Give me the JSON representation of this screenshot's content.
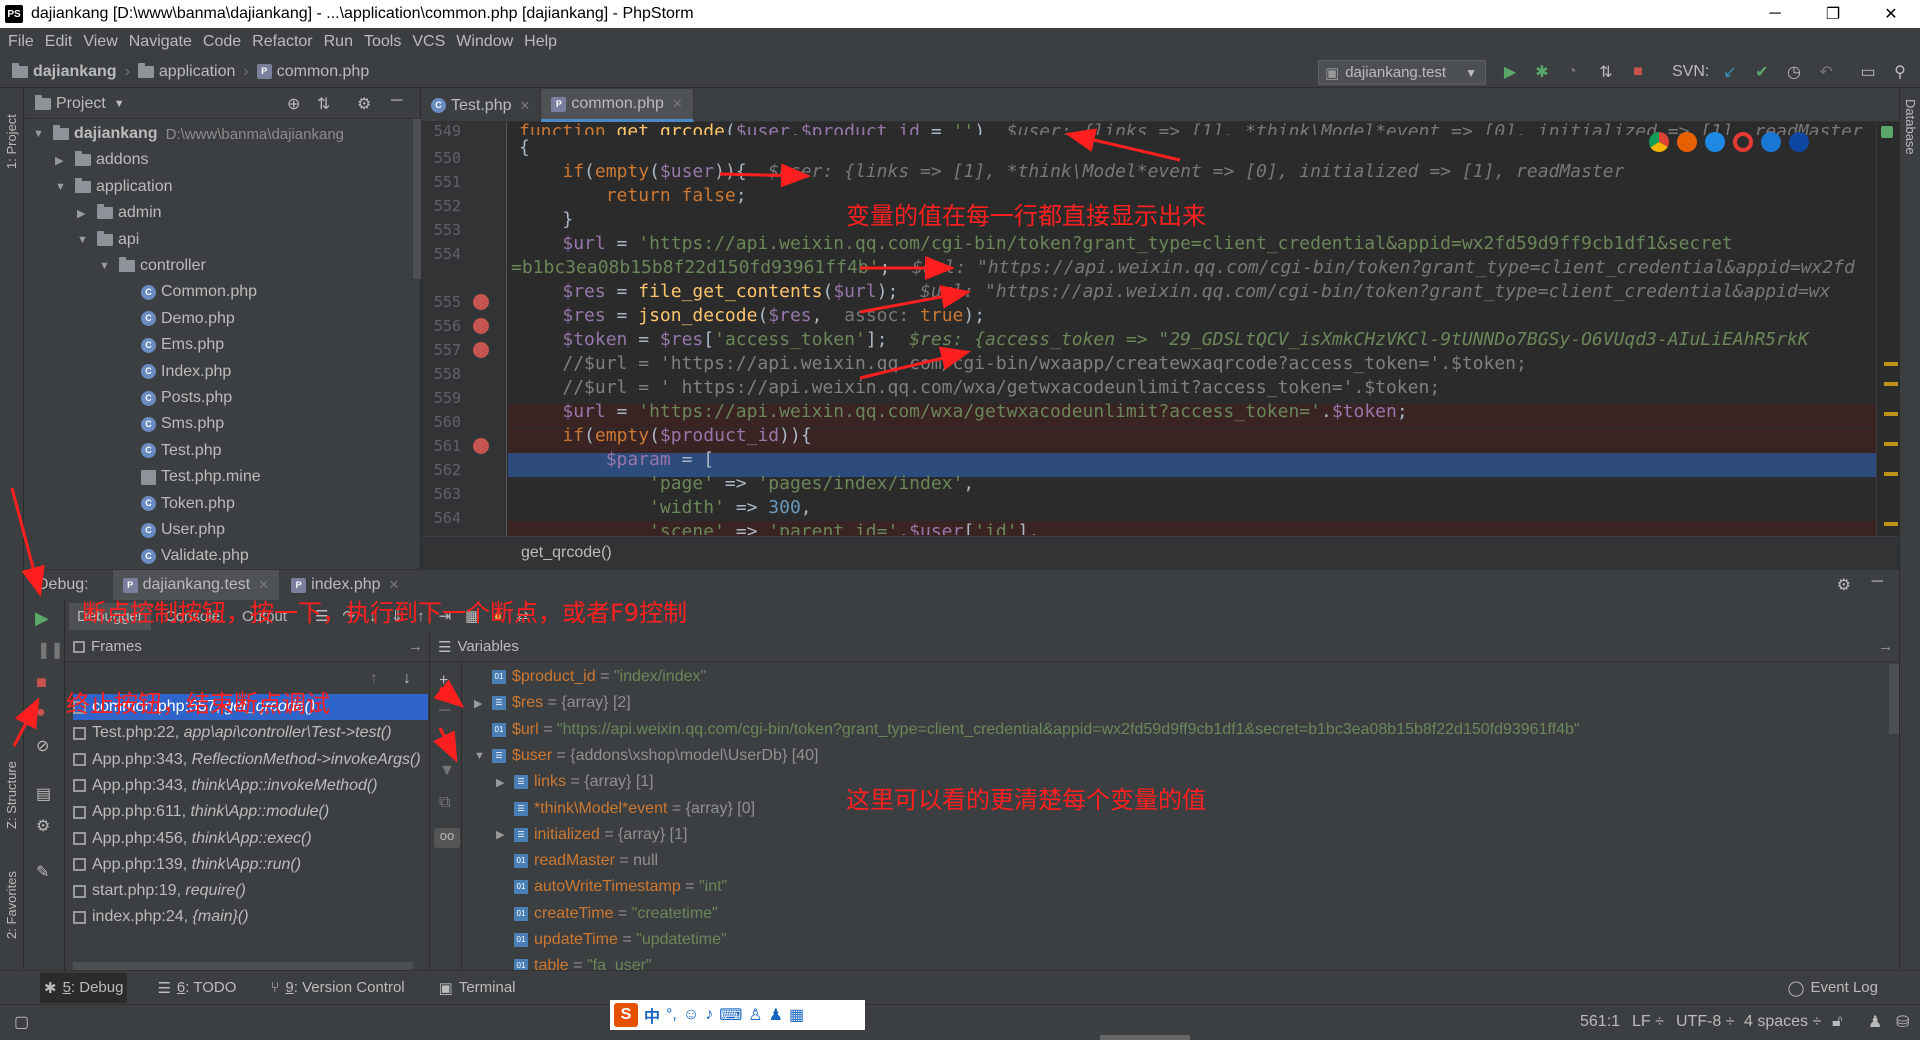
{
  "window": {
    "title": "dajiankang [D:\\www\\banma\\dajiankang] - ...\\application\\common.php [dajiankang] - PhpStorm",
    "logo": "PS"
  },
  "menu": [
    "File",
    "Edit",
    "View",
    "Navigate",
    "Code",
    "Refactor",
    "Run",
    "Tools",
    "VCS",
    "Window",
    "Help"
  ],
  "nav": {
    "root": "dajiankang",
    "folder": "application",
    "file": "common.php",
    "run_config": "dajiankang.test",
    "svn_label": "SVN:"
  },
  "project": {
    "header": "Project",
    "root_name": "dajiankang",
    "root_path": "D:\\www\\banma\\dajiankang",
    "items": [
      {
        "label": "addons",
        "type": "folder",
        "depth": 1,
        "arrow": "▶"
      },
      {
        "label": "application",
        "type": "folder",
        "depth": 1,
        "arrow": "▼"
      },
      {
        "label": "admin",
        "type": "folder",
        "depth": 2,
        "arrow": "▶"
      },
      {
        "label": "api",
        "type": "folder",
        "depth": 2,
        "arrow": "▼"
      },
      {
        "label": "controller",
        "type": "folder",
        "depth": 3,
        "arrow": "▼"
      },
      {
        "label": "Common.php",
        "type": "php",
        "depth": 4
      },
      {
        "label": "Demo.php",
        "type": "php",
        "depth": 4
      },
      {
        "label": "Ems.php",
        "type": "php",
        "depth": 4
      },
      {
        "label": "Index.php",
        "type": "php",
        "depth": 4
      },
      {
        "label": "Posts.php",
        "type": "php",
        "depth": 4
      },
      {
        "label": "Sms.php",
        "type": "php",
        "depth": 4
      },
      {
        "label": "Test.php",
        "type": "php",
        "depth": 4
      },
      {
        "label": "Test.php.mine",
        "type": "file",
        "depth": 4
      },
      {
        "label": "Token.php",
        "type": "php",
        "depth": 4
      },
      {
        "label": "User.php",
        "type": "php",
        "depth": 4
      },
      {
        "label": "Validate.php",
        "type": "php",
        "depth": 4
      }
    ]
  },
  "editor": {
    "tabs": [
      "Test.php",
      "common.php"
    ],
    "breadcrumb": "get_qrcode()",
    "line_numbers": [
      "549",
      "550",
      "551",
      "552",
      "553",
      "554",
      "",
      "555",
      "556",
      "557",
      "558",
      "559",
      "560",
      "561",
      "562",
      "563",
      "564",
      "565"
    ]
  },
  "debug": {
    "label": "Debug:",
    "tabs": [
      "dajiankang.test",
      "index.php"
    ],
    "toolbar": [
      "Debugger",
      "Console",
      "Output"
    ],
    "frames_header": "Frames",
    "variables_header": "Variables",
    "frames": [
      {
        "loc": "common.php:557,",
        "fn": "get_qrcode()"
      },
      {
        "loc": "Test.php:22,",
        "fn": "app\\api\\controller\\Test->test()"
      },
      {
        "loc": "App.php:343,",
        "fn": "ReflectionMethod->invokeArgs()"
      },
      {
        "loc": "App.php:343,",
        "fn": "think\\App::invokeMethod()"
      },
      {
        "loc": "App.php:611,",
        "fn": "think\\App::module()"
      },
      {
        "loc": "App.php:456,",
        "fn": "think\\App::exec()"
      },
      {
        "loc": "App.php:139,",
        "fn": "think\\App::run()"
      },
      {
        "loc": "start.php:19,",
        "fn": "require()"
      },
      {
        "loc": "index.php:24,",
        "fn": "{main}()"
      }
    ],
    "variables": [
      {
        "name": "$product_id",
        "value": "\"index/index\"",
        "arrow": "",
        "depth": 0
      },
      {
        "name": "$res",
        "value": "{array} [2]",
        "arrow": "▶",
        "depth": 0
      },
      {
        "name": "$url",
        "value": "\"https://api.weixin.qq.com/cgi-bin/token?grant_type=client_credential&appid=wx2fd59d9ff9cb1df1&secret=b1bc3ea08b15b8f22d150fd93961ff4b\"",
        "arrow": "",
        "depth": 0
      },
      {
        "name": "$user",
        "value": "{addons\\xshop\\model\\UserDb} [40]",
        "arrow": "▼",
        "depth": 0
      },
      {
        "name": "links",
        "value": "{array} [1]",
        "arrow": "▶",
        "depth": 1
      },
      {
        "name": "*think\\Model*event",
        "value": "{array} [0]",
        "arrow": "",
        "depth": 1
      },
      {
        "name": "initialized",
        "value": "{array} [1]",
        "arrow": "▶",
        "depth": 1
      },
      {
        "name": "readMaster",
        "value": "null",
        "arrow": "",
        "depth": 1
      },
      {
        "name": "autoWriteTimestamp",
        "value": "\"int\"",
        "arrow": "",
        "depth": 1
      },
      {
        "name": "createTime",
        "value": "\"createtime\"",
        "arrow": "",
        "depth": 1
      },
      {
        "name": "updateTime",
        "value": "\"updatetime\"",
        "arrow": "",
        "depth": 1
      },
      {
        "name": "table",
        "value": "\"fa_user\"",
        "arrow": "",
        "depth": 1
      }
    ]
  },
  "bottom_tabs": [
    {
      "num": "5",
      "label": ": Debug"
    },
    {
      "num": "6",
      "label": ": TODO"
    },
    {
      "num": "9",
      "label": ": Version Control"
    },
    {
      "num": "",
      "label": "Terminal"
    }
  ],
  "event_log": "Event Log",
  "status": {
    "position": "561:1",
    "line_sep": "LF ÷",
    "encoding": "UTF-8 ÷",
    "indent": "4 spaces ÷"
  },
  "side_tabs": {
    "project": "1: Project",
    "structure": "Z: Structure",
    "favorites": "2: Favorites",
    "database": "Database"
  },
  "annotations": {
    "inline_values": "变量的值在每一行都直接显示出来",
    "control_buttons": "断点控制按钮，按一下，执行到下一个断点，或者F9控制",
    "stop_button": "终止按钮，结束断点调试",
    "variables_panel": "这里可以看的更清楚每个变量的值"
  },
  "ime_label": "中"
}
